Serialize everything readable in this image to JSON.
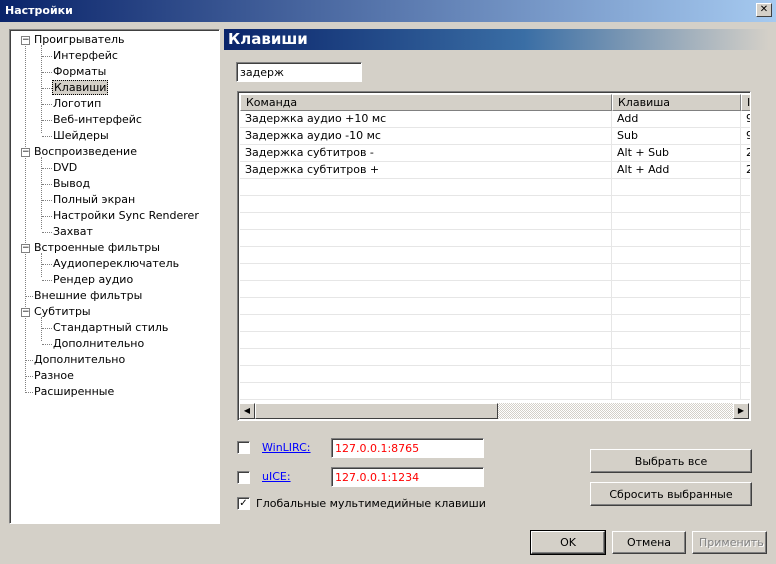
{
  "window": {
    "title": "Настройки",
    "close_glyph": "✕"
  },
  "tree": {
    "items": [
      {
        "label": "Проигрыватель",
        "expander": "−"
      },
      {
        "label": "Интерфейс"
      },
      {
        "label": "Форматы"
      },
      {
        "label": "Клавиши"
      },
      {
        "label": "Логотип"
      },
      {
        "label": "Веб-интерфейс"
      },
      {
        "label": "Шейдеры"
      },
      {
        "label": "Воспроизведение",
        "expander": "−"
      },
      {
        "label": "DVD"
      },
      {
        "label": "Вывод"
      },
      {
        "label": "Полный экран"
      },
      {
        "label": "Настройки Sync Renderer"
      },
      {
        "label": "Захват"
      },
      {
        "label": "Встроенные фильтры",
        "expander": "−"
      },
      {
        "label": "Аудиопереключатель"
      },
      {
        "label": "Рендер аудио"
      },
      {
        "label": "Внешние фильтры"
      },
      {
        "label": "Субтитры",
        "expander": "−"
      },
      {
        "label": "Стандартный стиль"
      },
      {
        "label": "Дополнительно"
      },
      {
        "label": "Дополнительно"
      },
      {
        "label": "Разное"
      },
      {
        "label": "Расширенные"
      }
    ]
  },
  "page": {
    "title": "Клавиши"
  },
  "search": {
    "value": "задерж"
  },
  "table": {
    "columns": [
      "Команда",
      "Клавиша",
      "I"
    ],
    "rows": [
      {
        "command": "Задержка аудио +10 мс",
        "key": "Add",
        "extra": "9"
      },
      {
        "command": "Задержка аудио -10 мс",
        "key": "Sub",
        "extra": "9"
      },
      {
        "command": "Задержка субтитров -",
        "key": "Alt + Sub",
        "extra": "2"
      },
      {
        "command": "Задержка субтитров +",
        "key": "Alt + Add",
        "extra": "2"
      }
    ]
  },
  "options": {
    "winlirc": {
      "label": "WinLIRC:",
      "value": "127.0.0.1:8765",
      "checked": false
    },
    "uice": {
      "label": "uICE:",
      "value": "127.0.0.1:1234",
      "checked": false
    },
    "global_keys": {
      "label": "Глобальные мультимедийные клавиши",
      "checked": true,
      "check_glyph": "✓"
    }
  },
  "buttons": {
    "select_all": "Выбрать все",
    "reset_selected": "Сбросить выбранные",
    "ok": "OK",
    "cancel": "Отмена",
    "apply": "Применить"
  },
  "scrollbar": {
    "left_glyph": "◀",
    "right_glyph": "▶"
  }
}
